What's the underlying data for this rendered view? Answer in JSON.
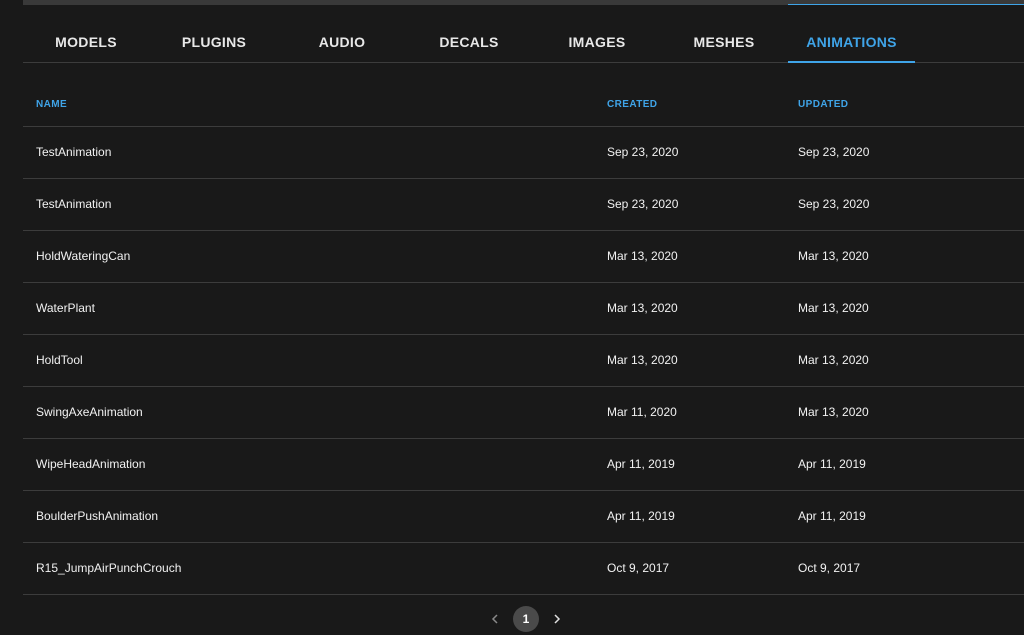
{
  "tabs": [
    {
      "label": "MODELS"
    },
    {
      "label": "PLUGINS"
    },
    {
      "label": "AUDIO"
    },
    {
      "label": "DECALS"
    },
    {
      "label": "IMAGES"
    },
    {
      "label": "MESHES"
    },
    {
      "label": "ANIMATIONS"
    }
  ],
  "active_tab": "ANIMATIONS",
  "table": {
    "headers": {
      "name": "NAME",
      "created": "CREATED",
      "updated": "UPDATED"
    },
    "rows": [
      {
        "name": "TestAnimation",
        "created": "Sep 23, 2020",
        "updated": "Sep 23, 2020"
      },
      {
        "name": "TestAnimation",
        "created": "Sep 23, 2020",
        "updated": "Sep 23, 2020"
      },
      {
        "name": "HoldWateringCan",
        "created": "Mar 13, 2020",
        "updated": "Mar 13, 2020"
      },
      {
        "name": "WaterPlant",
        "created": "Mar 13, 2020",
        "updated": "Mar 13, 2020"
      },
      {
        "name": "HoldTool",
        "created": "Mar 13, 2020",
        "updated": "Mar 13, 2020"
      },
      {
        "name": "SwingAxeAnimation",
        "created": "Mar 11, 2020",
        "updated": "Mar 13, 2020"
      },
      {
        "name": "WipeHeadAnimation",
        "created": "Apr 11, 2019",
        "updated": "Apr 11, 2019"
      },
      {
        "name": "BoulderPushAnimation",
        "created": "Apr 11, 2019",
        "updated": "Apr 11, 2019"
      },
      {
        "name": "R15_JumpAirPunchCrouch",
        "created": "Oct 9, 2017",
        "updated": "Oct 9, 2017"
      }
    ]
  },
  "pagination": {
    "current_page": "1",
    "prev_icon": "chevron-left-icon",
    "next_icon": "chevron-right-icon"
  },
  "colors": {
    "background": "#191919",
    "accent": "#3fa4e8",
    "divider": "#3c3c3c",
    "text": "#f2f2f2"
  }
}
